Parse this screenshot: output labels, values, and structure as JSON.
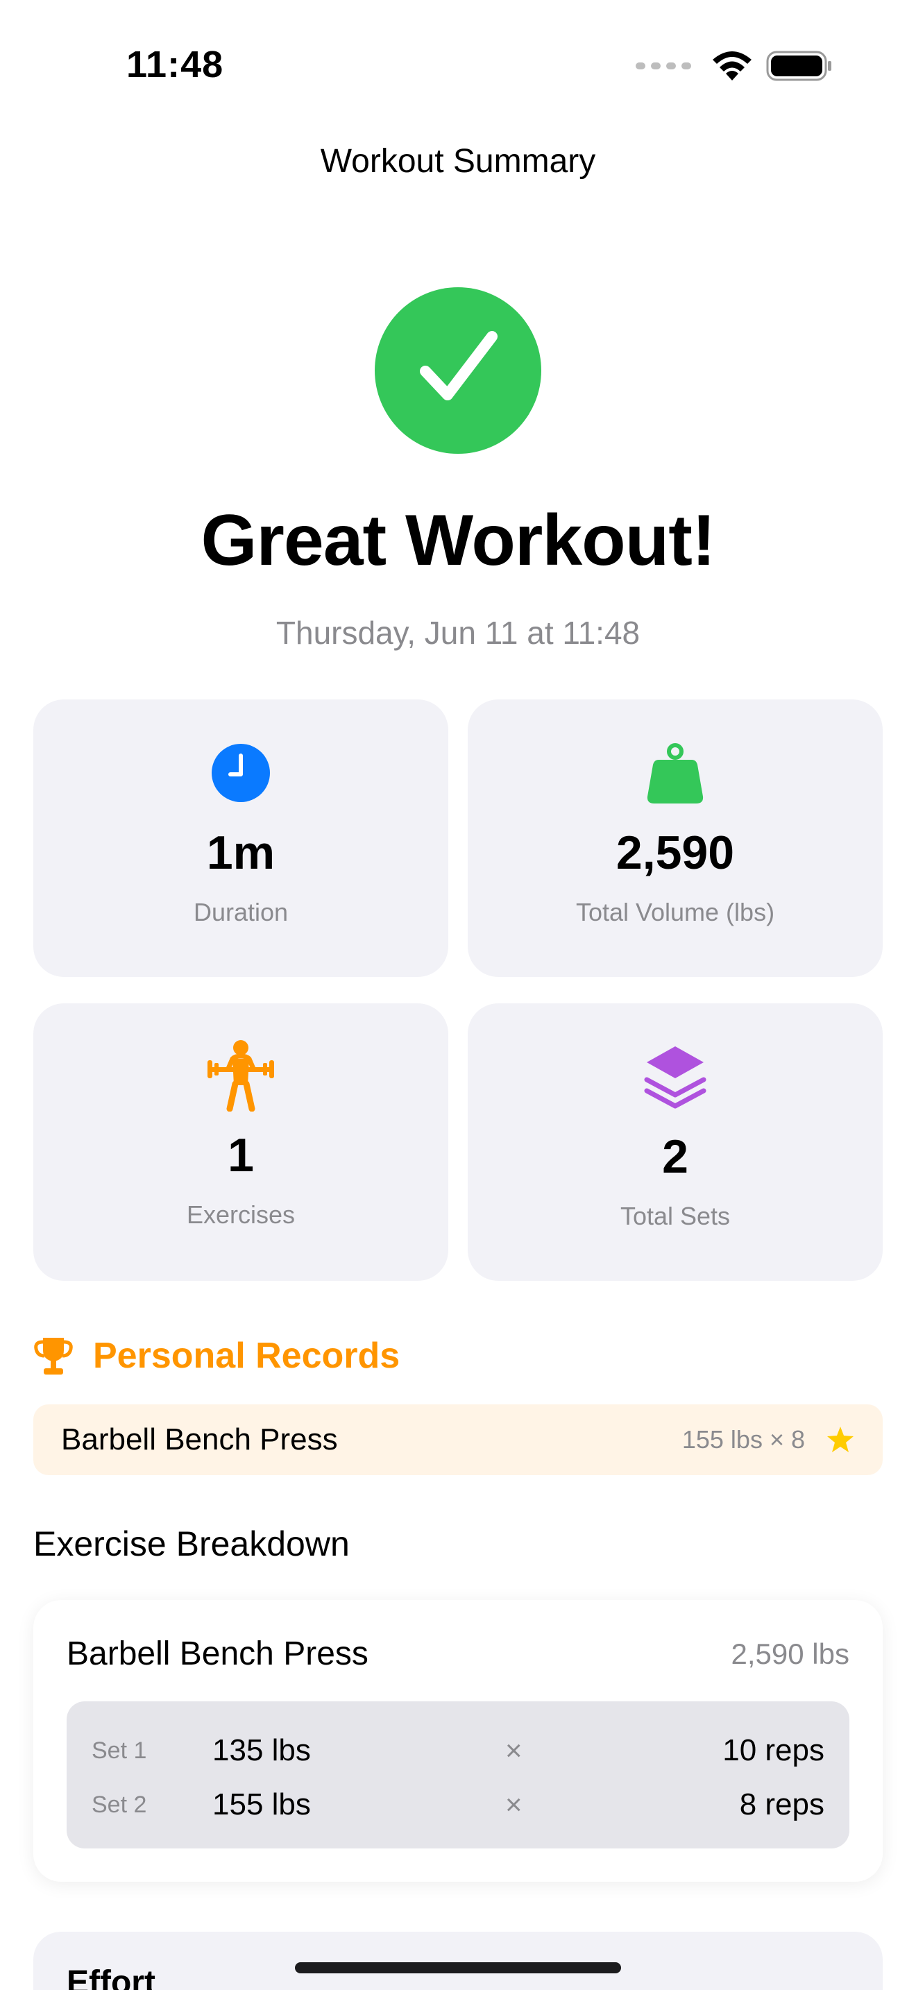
{
  "status_bar": {
    "time": "11:48"
  },
  "nav": {
    "title": "Workout Summary"
  },
  "hero": {
    "title": "Great Workout!",
    "date": "Thursday, Jun 11 at 11:48"
  },
  "stats": [
    {
      "value": "1m",
      "label": "Duration",
      "icon": "clock-icon",
      "color": "#0a7aff"
    },
    {
      "value": "2,590",
      "label": "Total Volume (lbs)",
      "icon": "scale-weight-icon",
      "color": "#34c759"
    },
    {
      "value": "1",
      "label": "Exercises",
      "icon": "weightlifter-icon",
      "color": "#ff9500"
    },
    {
      "value": "2",
      "label": "Total Sets",
      "icon": "stack-layers-icon",
      "color": "#af52de"
    }
  ],
  "personal_records": {
    "title": "Personal Records",
    "items": [
      {
        "exercise": "Barbell Bench Press",
        "detail": "155 lbs × 8"
      }
    ]
  },
  "breakdown": {
    "title": "Exercise Breakdown",
    "exercises": [
      {
        "name": "Barbell Bench Press",
        "volume": "2,590 lbs",
        "sets": [
          {
            "label": "Set 1",
            "weight": "135 lbs",
            "times": "×",
            "reps": "10 reps"
          },
          {
            "label": "Set 2",
            "weight": "155 lbs",
            "times": "×",
            "reps": "8 reps"
          }
        ]
      }
    ]
  },
  "effort": {
    "title": "Effort"
  }
}
